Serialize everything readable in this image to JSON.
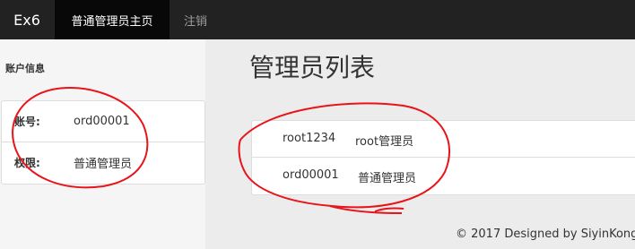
{
  "navbar": {
    "brand": "Ex6",
    "active_item": "普通管理员主页",
    "logout": "注销"
  },
  "sidebar": {
    "title": "账户信息",
    "rows": [
      {
        "label": "账号:",
        "value": "ord00001"
      },
      {
        "label": "权限:",
        "value": "普通管理员"
      }
    ]
  },
  "main": {
    "title": "管理员列表",
    "admins": [
      {
        "username": "root1234",
        "role": "root管理员"
      },
      {
        "username": "ord00001",
        "role": "普通管理员"
      }
    ]
  },
  "footer": {
    "text": "© 2017 Designed by SiyinKong."
  },
  "colors": {
    "navbar_bg": "#222222",
    "nav_active_bg": "#080808",
    "annotation_red": "#e8141a"
  }
}
